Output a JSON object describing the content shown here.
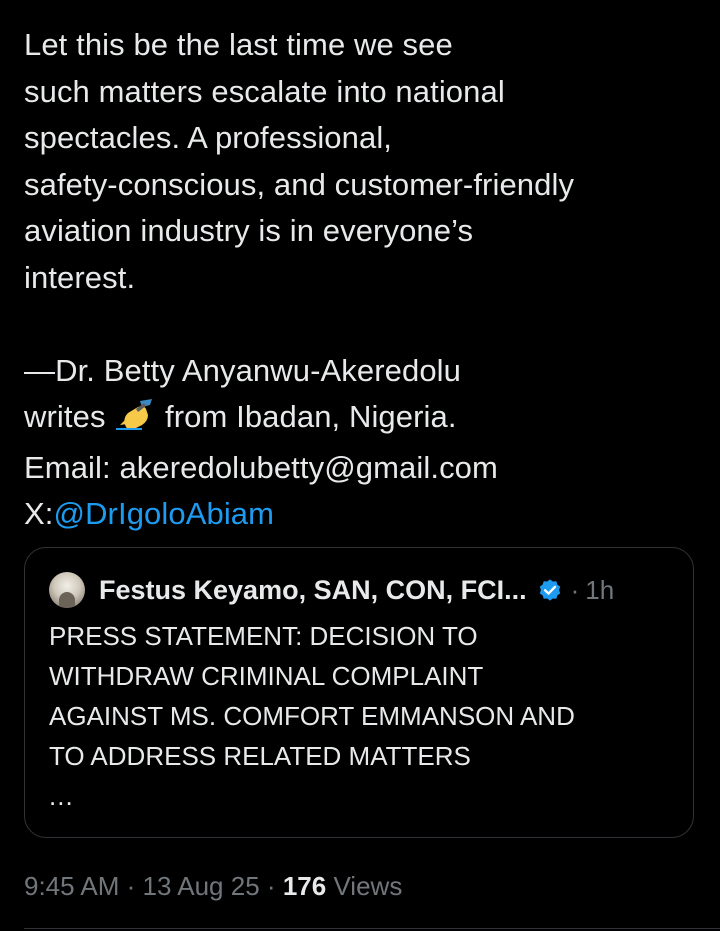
{
  "post": {
    "lines": [
      "Let this be the last time we see",
      "such matters escalate into national",
      "spectacles. A professional,",
      "safety-conscious, and customer-friendly",
      "aviation industry is in everyone’s",
      "interest."
    ],
    "signature": "—Dr. Betty Anyanwu-Akeredolu",
    "writes_prefix": "writes",
    "writes_emoji": "✍️",
    "writes_suffix": "from Ibadan, Nigeria.",
    "email_line": "Email: akeredolubetty@gmail.com",
    "x_prefix": "X:",
    "x_handle": "@DrIgoloAbiam"
  },
  "quote": {
    "author_name": "Festus Keyamo, SAN, CON, FCI...",
    "separator": "·",
    "time_ago": "1h",
    "lines": [
      "PRESS STATEMENT: DECISION TO",
      "WITHDRAW CRIMINAL COMPLAINT",
      "AGAINST MS. COMFORT EMMANSON AND",
      "TO ADDRESS RELATED MATTERS"
    ],
    "ellipsis": "...",
    "verified_color": "#1d9bf0",
    "avatar_icon": "profile-photo"
  },
  "meta": {
    "time": "9:45 AM",
    "sep1": "·",
    "date": "13 Aug 25",
    "sep2": "·",
    "views_count": "176",
    "views_label": "Views"
  },
  "colors": {
    "background": "#000000",
    "text": "#e7e9ea",
    "muted": "#71767b",
    "link": "#1d9bf0",
    "border": "#2f3336"
  }
}
